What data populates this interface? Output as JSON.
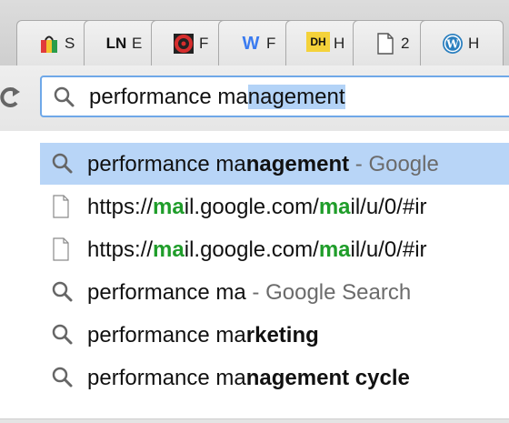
{
  "tabs": [
    {
      "favicon": "colorful-bag-icon",
      "title": "S",
      "color": "#cc3333"
    },
    {
      "favicon": "LN",
      "title": "E",
      "color": "#111111"
    },
    {
      "favicon": "swirl-icon",
      "title": "F",
      "color": "#d62d2d"
    },
    {
      "favicon": "W",
      "title": "F",
      "color": "#3a7bf0"
    },
    {
      "favicon": "DH",
      "title": "H",
      "color": "#222222"
    },
    {
      "favicon": "page-icon",
      "title": "2",
      "color": "#555555"
    },
    {
      "favicon": "wordpress-icon",
      "title": "H",
      "color": "#2a7fbf"
    }
  ],
  "omnibox": {
    "typed": "performance ma",
    "autocomplete": "nagement"
  },
  "suggestions": [
    {
      "icon": "search-icon",
      "prefix": "performance ma",
      "bold": "nagement",
      "suffix": " - Google",
      "highlighted": true
    },
    {
      "icon": "page-icon",
      "url_parts": [
        "https://",
        "ma",
        "il.google.com/",
        "ma",
        "il/u/0/#ir"
      ]
    },
    {
      "icon": "page-icon",
      "url_parts": [
        "https://",
        "ma",
        "il.google.com/",
        "ma",
        "il/u/0/#ir"
      ]
    },
    {
      "icon": "search-icon",
      "prefix": "performance ma",
      "bold": "",
      "suffix": " - Google Search"
    },
    {
      "icon": "search-icon",
      "prefix": "performance ma",
      "bold": "rketing",
      "suffix": ""
    },
    {
      "icon": "search-icon",
      "prefix": "performance ma",
      "bold": "nagement cycle",
      "suffix": ""
    }
  ]
}
